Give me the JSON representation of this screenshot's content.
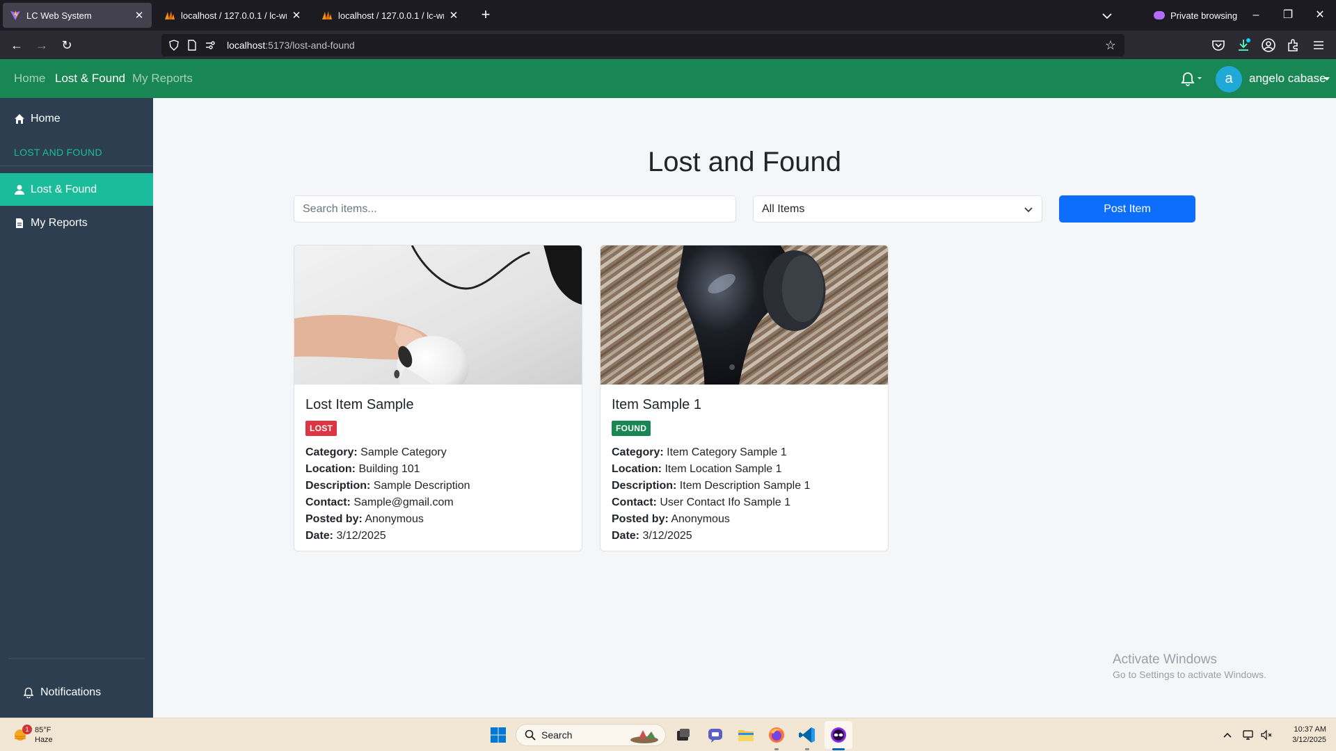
{
  "browser": {
    "tabs": [
      {
        "title": "LC Web System",
        "active": true
      },
      {
        "title": "localhost / 127.0.0.1 / lc-wm-da",
        "active": false
      },
      {
        "title": "localhost / 127.0.0.1 / lc-wm-da",
        "active": false
      }
    ],
    "private_label": "Private browsing",
    "url_host": "localhost",
    "url_rest": ":5173/lost-and-found"
  },
  "topnav": {
    "links": [
      "Home",
      "Lost & Found",
      "My Reports"
    ],
    "active": "Lost & Found",
    "user_initial": "a",
    "user_name": "angelo cabase"
  },
  "sidebar": {
    "home": "Home",
    "section_heading": "LOST AND FOUND",
    "items": [
      "Lost & Found",
      "My Reports"
    ],
    "active": "Lost & Found",
    "notifications": "Notifications"
  },
  "main": {
    "title": "Lost and Found",
    "search_placeholder": "Search items...",
    "filter_value": "All Items",
    "post_button": "Post Item"
  },
  "cards": [
    {
      "title": "Lost Item Sample",
      "status": "LOST",
      "category": "Sample Category",
      "location": "Building 101",
      "description": "Sample Description",
      "contact": "Sample@gmail.com",
      "posted_by": "Anonymous",
      "date": "3/12/2025"
    },
    {
      "title": "Item Sample 1",
      "status": "FOUND",
      "category": "Item Category Sample 1",
      "location": "Item Location Sample 1",
      "description": "Item Description Sample 1",
      "contact": "User Contact Ifo Sample 1",
      "posted_by": "Anonymous",
      "date": "3/12/2025"
    }
  ],
  "labels": {
    "category": "Category:",
    "location": "Location:",
    "description": "Description:",
    "contact": "Contact:",
    "posted_by": "Posted by:",
    "date": "Date:"
  },
  "watermark": {
    "line1": "Activate Windows",
    "line2": "Go to Settings to activate Windows."
  },
  "taskbar": {
    "weather_temp": "85°F",
    "weather_desc": "Haze",
    "weather_badge": "1",
    "search_label": "Search",
    "time": "10:37 AM",
    "date": "3/12/2025"
  },
  "colors": {
    "header_green": "#198754",
    "sidebar_bg": "#2c3e50",
    "sidebar_accent": "#1abc9c",
    "primary": "#0d6efd",
    "lost": "#dc3545",
    "found": "#198754"
  }
}
